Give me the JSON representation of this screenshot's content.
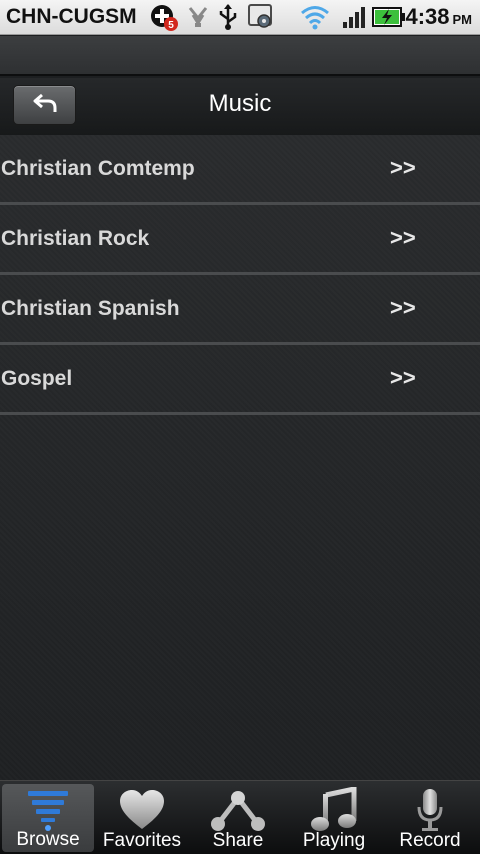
{
  "status_bar": {
    "carrier": "CHN-CUGSM",
    "notification_count": "5",
    "time": "4:38",
    "ampm": "PM"
  },
  "header": {
    "title": "Music",
    "back_icon": "back-arrow-icon"
  },
  "list": {
    "items": [
      {
        "label": "Christian Comtemp",
        "arrow": ">>"
      },
      {
        "label": "Christian Rock",
        "arrow": ">>"
      },
      {
        "label": "Christian Spanish",
        "arrow": ">>"
      },
      {
        "label": "Gospel",
        "arrow": ">>"
      }
    ]
  },
  "tabs": [
    {
      "label": "Browse",
      "icon": "browse-icon",
      "active": true
    },
    {
      "label": "Favorites",
      "icon": "heart-icon",
      "active": false
    },
    {
      "label": "Share",
      "icon": "share-icon",
      "active": false
    },
    {
      "label": "Playing",
      "icon": "music-note-icon",
      "active": false
    },
    {
      "label": "Record",
      "icon": "microphone-icon",
      "active": false
    }
  ],
  "colors": {
    "accent_blue": "#2f7ad8",
    "battery_green": "#3cc03c",
    "notification_red": "#d2281e"
  }
}
